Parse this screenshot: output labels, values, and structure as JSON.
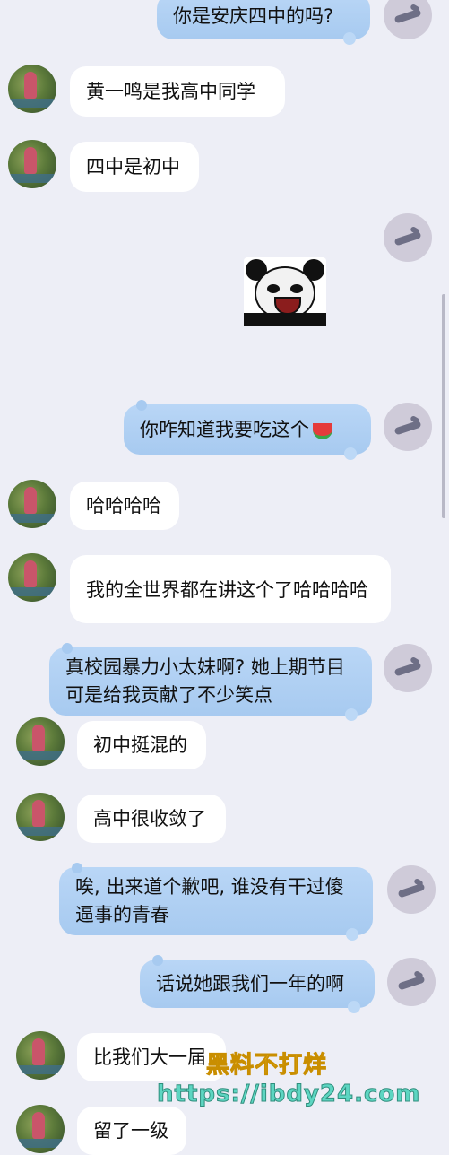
{
  "messages": [
    {
      "side": "out",
      "text": "你是安庆四中的吗?"
    },
    {
      "side": "in",
      "text": "黄一鸣是我高中同学"
    },
    {
      "side": "in",
      "text": "四中是初中"
    },
    {
      "side": "out",
      "sticker": "panda-laughing-sticker"
    },
    {
      "side": "out",
      "text": "你咋知道我要吃这个"
    },
    {
      "side": "in",
      "text": "哈哈哈哈"
    },
    {
      "side": "in",
      "text": "我的全世界都在讲这个了哈哈哈哈"
    },
    {
      "side": "out",
      "text": "真校园暴力小太妹啊? 她上期节目可是给我贡献了不少笑点"
    },
    {
      "side": "in",
      "text": "初中挺混的"
    },
    {
      "side": "in",
      "text": "高中很收敛了"
    },
    {
      "side": "out",
      "text": "唉, 出来道个歉吧, 谁没有干过傻逼事的青春"
    },
    {
      "side": "out",
      "text": "话说她跟我们一年的啊"
    },
    {
      "side": "in",
      "text": "比我们大一届"
    },
    {
      "side": "in",
      "text": "留了一级"
    }
  ],
  "watermark": {
    "line1": "黑料不打烊",
    "line2": "https://ibdy24.com"
  },
  "colors": {
    "background": "#edeef6",
    "incoming_bubble": "#ffffff",
    "outgoing_bubble": "#aecdf3"
  }
}
